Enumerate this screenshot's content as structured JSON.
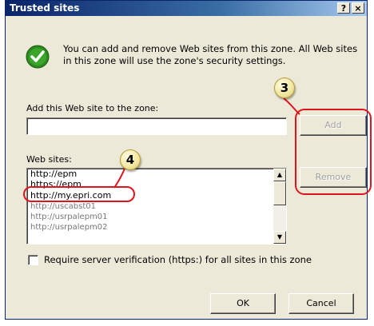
{
  "window": {
    "title": "Trusted sites",
    "help_label": "?",
    "close_label": "×"
  },
  "info_text": "You can add and remove Web sites from this zone. All Web sites in this zone will use the zone's security settings.",
  "add_section": {
    "label": "Add this Web site to the zone:",
    "value": ""
  },
  "buttons": {
    "add": "Add",
    "remove": "Remove",
    "ok": "OK",
    "cancel": "Cancel"
  },
  "websites": {
    "label": "Web sites:",
    "items": [
      "http://epm",
      "https://epm",
      "http://my.epri.com",
      "http://uscabst01",
      "http://usrpalepm01",
      "http://usrpalepm02"
    ]
  },
  "require_verification": {
    "label": "Require server verification (https:) for all sites in this zone",
    "checked": false
  },
  "annotations": {
    "step3": "3",
    "step4": "4"
  },
  "colors": {
    "title_gradient_start": "#0a246a",
    "annotation_red": "#e0141c",
    "dialog_bg": "#ece9d8",
    "check_green": "#2c8a1e"
  }
}
